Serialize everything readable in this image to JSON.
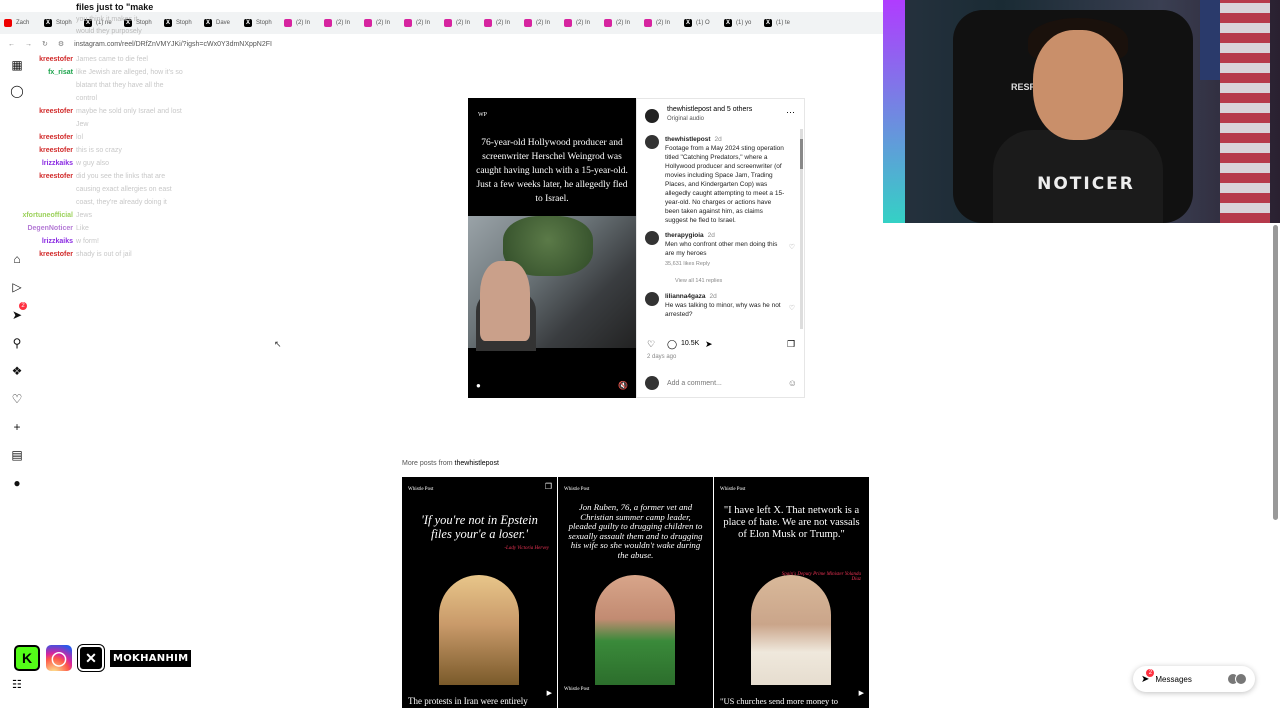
{
  "browser": {
    "tabs": [
      {
        "icon": "youtube",
        "label": "Zach"
      },
      {
        "icon": "x",
        "label": "Stoph"
      },
      {
        "icon": "x",
        "label": "(1) ne"
      },
      {
        "icon": "x",
        "label": "Stoph"
      },
      {
        "icon": "x",
        "label": "Stoph"
      },
      {
        "icon": "x",
        "label": "Dave"
      },
      {
        "icon": "x",
        "label": "Stoph"
      },
      {
        "icon": "instagram",
        "label": "(2) In"
      },
      {
        "icon": "instagram",
        "label": "(2) In"
      },
      {
        "icon": "instagram",
        "label": "(2) In"
      },
      {
        "icon": "instagram",
        "label": "(2) In"
      },
      {
        "icon": "instagram",
        "label": "(2) In"
      },
      {
        "icon": "instagram",
        "label": "(2) In"
      },
      {
        "icon": "instagram",
        "label": "(2) In"
      },
      {
        "icon": "instagram",
        "label": "(2) In"
      },
      {
        "icon": "instagram",
        "label": "(2) In"
      },
      {
        "icon": "instagram",
        "label": "(2) In"
      },
      {
        "icon": "x",
        "label": "(1) O"
      },
      {
        "icon": "x",
        "label": "(1) yo"
      },
      {
        "icon": "x",
        "label": "(1) te"
      }
    ],
    "url": "instagram.com/reel/DRfZnVMYJKi/?igsh=cWx0Y3dmNXppN2FI"
  },
  "chat": {
    "title": "files just to \"make",
    "under_lines": [
      "you think it makes it",
      "would they purposely"
    ],
    "messages": [
      {
        "user": "kreestofer",
        "color": "#d12a2a",
        "text": "James came to die feel"
      },
      {
        "user": "fx_risat",
        "color": "#1aa34a",
        "text": "like Jewish are alleged, how it's so blatant that they have all the control"
      },
      {
        "user": "kreestofer",
        "color": "#d12a2a",
        "text": "maybe he sold only Israel and lost Jew"
      },
      {
        "user": "kreestofer",
        "color": "#d12a2a",
        "text": "lol"
      },
      {
        "user": "kreestofer",
        "color": "#d12a2a",
        "text": "this is so crazy"
      },
      {
        "user": "lrizzkaiks",
        "color": "#8a2be2",
        "text": "w guy also"
      },
      {
        "user": "kreestofer",
        "color": "#d12a2a",
        "text": "did you see the links that are causing exact allergies on east coast, they're already doing it"
      },
      {
        "user": "xfortuneofficial",
        "color": "#9bd15a",
        "text": "Jews"
      },
      {
        "user": "DegenNoticer",
        "color": "#b57bd6",
        "text": "Like"
      },
      {
        "user": "lrizzkaiks",
        "color": "#8a2be2",
        "text": "w form!"
      },
      {
        "user": "kreestofer",
        "color": "#d12a2a",
        "text": "shady is out of jail"
      }
    ]
  },
  "post": {
    "brand": "WP",
    "headline": "76-year-old Hollywood producer and screenwriter Herschel Weingrod was caught having lunch with a 15-year-old. Just a few weeks later, he allegedly fled to Israel.",
    "author": "thewhistlepost and 5 others",
    "audio": "Original audio",
    "comments": [
      {
        "user": "thewhistlepost",
        "time": "2d",
        "text": "Footage from a May 2024 sting operation titled \"Catching Predators,\" where a Hollywood producer and screenwriter (of movies including Space Jam, Trading Places, and Kindergarten Cop) was allegedly caught attempting to meet a 15-year-old. No charges or actions have been taken against him, as claims suggest he fled to Israel.",
        "meta": ""
      },
      {
        "user": "therapygioia",
        "time": "2d",
        "text": "Men who confront other men doing this are my heroes",
        "meta": "35,631 likes   Reply"
      },
      {
        "user": "",
        "time": "",
        "text": "",
        "meta": "View all 141 replies"
      },
      {
        "user": "lilianna4gaza",
        "time": "2d",
        "text": "He was talking to minor, why was he not arrested?",
        "meta": ""
      }
    ],
    "likes": "10.5K",
    "date": "2 days ago",
    "add_comment": "Add a comment..."
  },
  "more_posts": {
    "label": "More posts from",
    "account": "thewhistlepost",
    "tiles": [
      {
        "brand": "Whistle Post",
        "quote": "'If you're not in Epstein files your'e a loser.'",
        "attribution": "-Lady Victoria Hervey",
        "caption": "The protests in Iran were entirely"
      },
      {
        "brand": "Whistle Post",
        "quote": "Jon Ruben, 76, a former vet and Christian summer camp leader, pleaded guilty to drugging children to sexually assault them and to drugging his wife so she wouldn't wake during the abuse.",
        "attribution": "",
        "caption": "Whistle Post"
      },
      {
        "brand": "Whistle Post",
        "quote": "\"I have left X. That network is a place of hate. We are not vassals of Elon Musk or Trump.\"",
        "attribution": "Spain's Deputy Prime Minister Yolanda Diaz",
        "caption": "\"US churches send more money to"
      }
    ]
  },
  "webcam": {
    "shirt": "NOTICER",
    "chair": "RESP"
  },
  "socials": {
    "handle": "MOKHANHIM"
  },
  "messages_pill": {
    "label": "Messages",
    "badge": "2"
  },
  "rail_badge": "2"
}
